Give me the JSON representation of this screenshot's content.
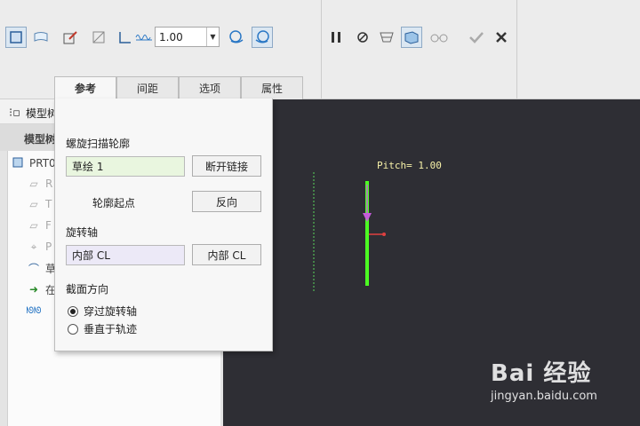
{
  "toolbar": {
    "pitch_value": "1.00",
    "icons": [
      "solid-icon",
      "surface-icon",
      "sketch-icon",
      "thin-icon",
      "profile-icon",
      "helix-icon",
      "left-hand-icon",
      "right-hand-icon",
      "pause-icon",
      "no-preview-icon",
      "preview-icon",
      "verify-icon",
      "glasses-icon",
      "ok-icon",
      "cancel-icon"
    ]
  },
  "tabs": [
    {
      "label": "参考"
    },
    {
      "label": "间距"
    },
    {
      "label": "选项"
    },
    {
      "label": "属性"
    }
  ],
  "tree": {
    "header": "模型树",
    "header2": "模型树",
    "root": "PRT0",
    "items": [
      {
        "label": "R",
        "icon": "plane-icon"
      },
      {
        "label": "T",
        "icon": "plane-icon"
      },
      {
        "label": "F",
        "icon": "plane-icon"
      },
      {
        "label": "P",
        "icon": "csys-icon"
      },
      {
        "label": "草",
        "icon": "sketch-icon"
      },
      {
        "label": "在",
        "icon": "insert-arrow-icon"
      },
      {
        "label": "",
        "icon": "helix-feature-icon"
      }
    ]
  },
  "panel": {
    "profile_label": "螺旋扫描轮廓",
    "profile_value": "草绘 1",
    "break_link": "断开链接",
    "start_label": "轮廓起点",
    "flip": "反向",
    "axis_label": "旋转轴",
    "axis_value": "内部 CL",
    "axis_button": "内部 CL",
    "section_label": "截面方向",
    "radio_through": "穿过旋转轴",
    "radio_normal": "垂直于轨迹"
  },
  "viewport": {
    "pitch_text": "Pitch= 1.00"
  },
  "watermark": {
    "brand": "Bai 经验",
    "url": "jingyan.baidu.com"
  }
}
